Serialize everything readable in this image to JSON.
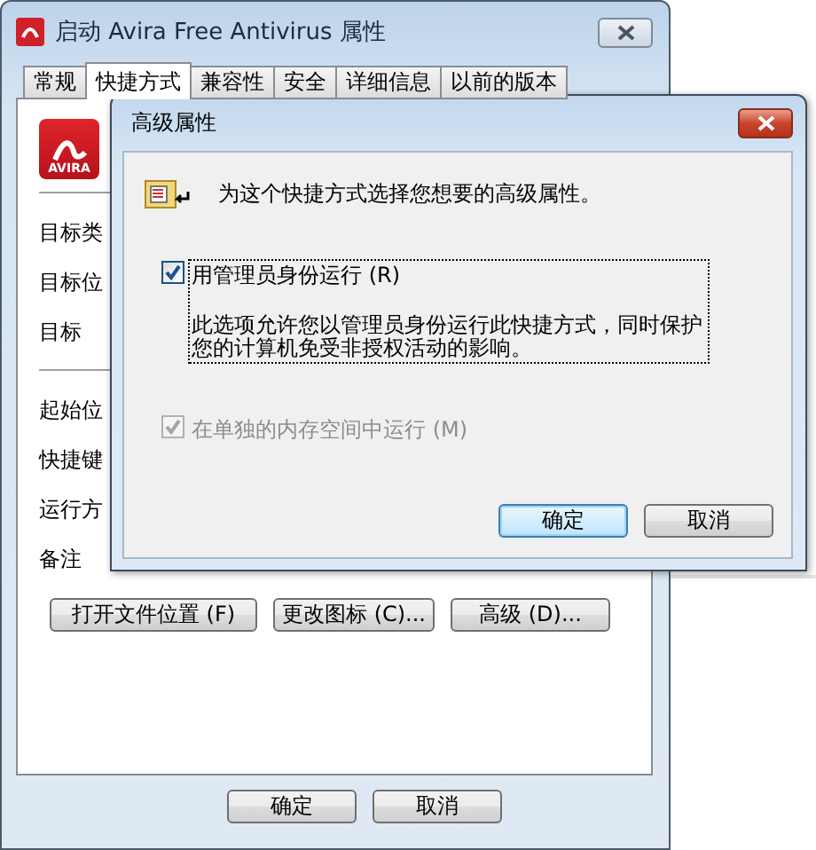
{
  "window": {
    "title": "启动 Avira Free Antivirus 属性",
    "tabs": [
      {
        "label": "常规",
        "selected": false
      },
      {
        "label": "快捷方式",
        "selected": true
      },
      {
        "label": "兼容性",
        "selected": false
      },
      {
        "label": "安全",
        "selected": false
      },
      {
        "label": "详细信息",
        "selected": false
      },
      {
        "label": "以前的版本",
        "selected": false
      }
    ],
    "logo": "AVIRA",
    "sections": [
      {
        "fields": [
          "目标类",
          "目标位",
          "目标 "
        ]
      },
      {
        "fields": [
          "起始位",
          "快捷键",
          "运行方",
          "备注 "
        ]
      }
    ],
    "buttons": [
      "打开文件位置 (F)",
      "更改图标 (C)...",
      "高级 (D)..."
    ],
    "footer_buttons": [
      "确定",
      "取消"
    ]
  },
  "dialog": {
    "title": "高级属性",
    "intro": "为这个快捷方式选择您想要的高级属性。",
    "options": [
      {
        "label": "用管理员身份运行 (R)",
        "checked": true,
        "disabled": false,
        "focused": true,
        "description": "此选项允许您以管理员身份运行此快捷方式，同时保护您的计算机免受非授权活动的影响。"
      },
      {
        "label": "在单独的内存空间中运行 (M)",
        "checked": true,
        "disabled": true,
        "focused": false
      }
    ],
    "buttons": [
      {
        "label": "确定",
        "default": true
      },
      {
        "label": "取消",
        "default": false
      }
    ]
  }
}
